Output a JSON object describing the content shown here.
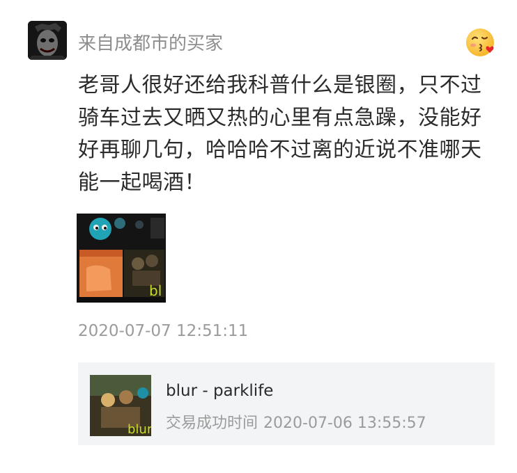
{
  "review": {
    "buyer_name": "来自成都市的买家",
    "comment": "老哥人很好还给我科普什么是银圈，只不过骑车过去又晒又热的心里有点急躁，没能好好再聊几句，哈哈哈不过离的近说不准哪天能一起喝酒！",
    "timestamp": "2020-07-07 12:51:11",
    "emoji_badge_icon": "kissing-face-with-heart-icon"
  },
  "order": {
    "product_title": "blur - parklife",
    "status_label": "交易成功时间",
    "status_time": "2020-07-06 13:55:57"
  },
  "colors": {
    "text_primary": "#2b2b2b",
    "text_secondary": "#9b9b9b",
    "card_background": "#f3f4f6"
  }
}
